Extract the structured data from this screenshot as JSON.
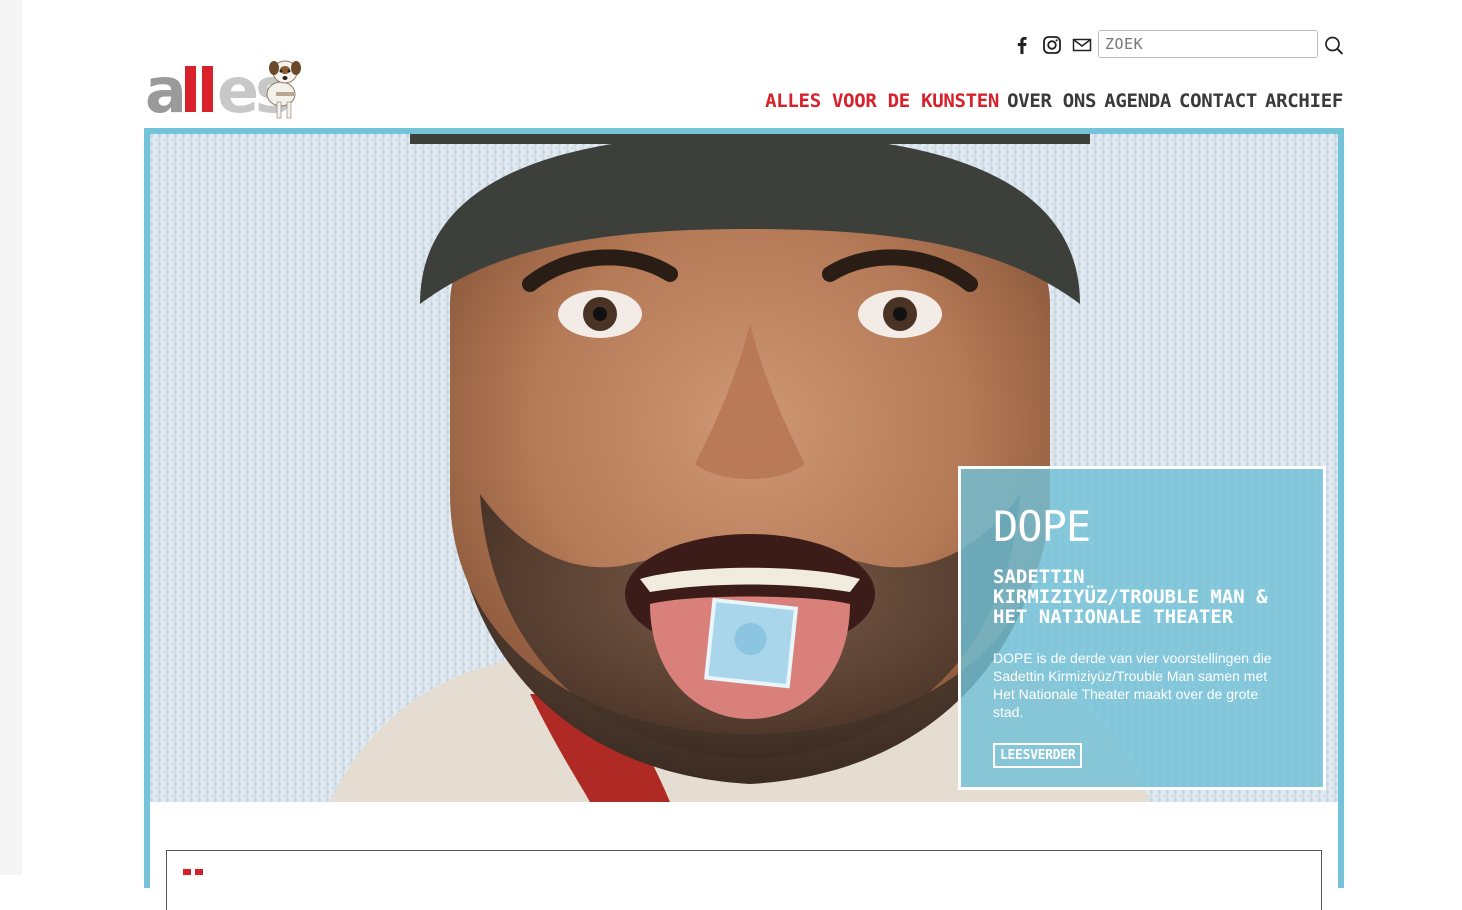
{
  "brand": {
    "logo_text": "alles",
    "accent": "#d8212b",
    "frame_color": "#74c3d8"
  },
  "header": {
    "social": [
      "facebook-icon",
      "instagram-icon",
      "mail-icon"
    ],
    "search": {
      "placeholder": "ZOEK"
    },
    "nav": [
      {
        "label": "ALLES VOOR DE KUNSTEN",
        "active": true
      },
      {
        "label": "OVER ONS",
        "active": false
      },
      {
        "label": "AGENDA",
        "active": false
      },
      {
        "label": "CONTACT",
        "active": false
      },
      {
        "label": "ARCHIEF",
        "active": false
      }
    ]
  },
  "hero": {
    "title": "DOPE",
    "subtitle": "SADETTIN KIRMIZIYÜZ/TROUBLE MAN & HET NATIONALE THEATER",
    "text": "DOPE is de derde van vier voorstellingen die Sadettin Kirmiziyüz/Trouble Man samen met Het Nationale Theater maakt over de grote stad.",
    "button": "LEESVERDER"
  }
}
